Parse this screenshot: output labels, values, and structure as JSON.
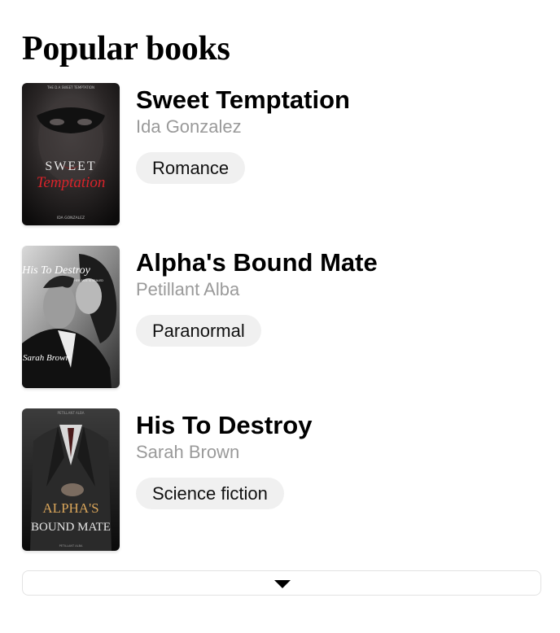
{
  "section": {
    "title": "Popular books"
  },
  "books": [
    {
      "title": "Sweet Temptation",
      "author": "Ida Gonzalez",
      "genre": "Romance",
      "cover": {
        "top_text": "THE D.A SWEET TEMPTATION",
        "title_line1": "SWEET",
        "title_line2": "Temptation",
        "author_text": "IDA GONZALEZ"
      }
    },
    {
      "title": "Alpha's Bound Mate",
      "author": "Petillant Alba",
      "genre": "Paranormal",
      "cover": {
        "title_text": "His To Destroy",
        "subtitle_text": "HER FATE IS SEALED",
        "author_text": "Sarah Brown"
      }
    },
    {
      "title": "His To Destroy",
      "author": "Sarah Brown",
      "genre": "Science fiction",
      "cover": {
        "top_text": "PETILLANT ALBA",
        "title_line1": "ALPHA'S",
        "title_line2": "BOUND MATE",
        "bottom_text": "PETILLANT ALBA"
      }
    }
  ],
  "colors": {
    "author_gray": "#9a9a9a",
    "chip_background": "#f0f0f0",
    "cover1_title_red": "#d8232a",
    "cover3_title_gold": "#d9a55a"
  },
  "icons": {
    "more_button": "caret-down-icon"
  }
}
